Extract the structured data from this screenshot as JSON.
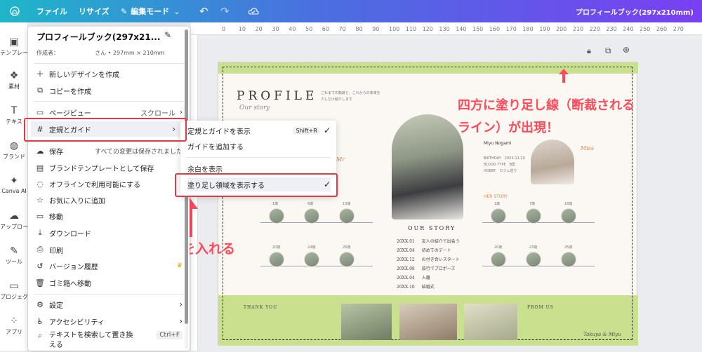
{
  "topbar": {
    "home_icon": "home-icon",
    "file": "ファイル",
    "resize": "リサイズ",
    "edit_mode": "編集モード",
    "doc_title": "プロフィールブック(297x210mm)"
  },
  "rail": [
    {
      "label": "テンプレー",
      "icon": "template-icon"
    },
    {
      "label": "素材",
      "icon": "elements-icon"
    },
    {
      "label": "テキス",
      "icon": "text-icon"
    },
    {
      "label": "ブランド",
      "icon": "brand-icon"
    },
    {
      "label": "Canva AI",
      "icon": "ai-icon"
    },
    {
      "label": "アップロー",
      "icon": "upload-icon"
    },
    {
      "label": "ツール",
      "icon": "tools-icon"
    },
    {
      "label": "プロジェク",
      "icon": "projects-icon"
    },
    {
      "label": "アプリ",
      "icon": "apps-icon"
    }
  ],
  "menu": {
    "title": "プロフィールブック(297x21...",
    "author_label": "作成者：",
    "author_suffix": "さん • 297mm × 210mm",
    "items": {
      "new_design": "新しいデザインを作成",
      "copy": "コピーを作成",
      "page_view": "ページビュー",
      "page_view_value": "スクロール",
      "rulers_guides": "定規とガイド",
      "save": "保存",
      "save_status": "すべての変更は保存されました",
      "save_brand": "ブランドテンプレートとして保存",
      "offline": "オフラインで利用可能にする",
      "favorite": "お気に入りに追加",
      "move": "移動",
      "download": "ダウンロード",
      "print": "印刷",
      "version": "バージョン履歴",
      "trash": "ゴミ箱へ移動",
      "settings": "設定",
      "accessibility": "アクセシビリティ",
      "find_replace": "テキストを検索して置き換",
      "find_replace_2": "える",
      "find_shortcut": "Ctrl+F"
    }
  },
  "submenu": {
    "show_rulers": "定規とガイドを表示",
    "show_rulers_shortcut": "Shift+R",
    "add_guides": "ガイドを追加する",
    "show_margins": "余白を表示",
    "show_bleed": "塗り足し領域を表示する"
  },
  "ruler_ticks": [
    "0",
    "10",
    "20",
    "30",
    "40",
    "50",
    "60",
    "70",
    "80",
    "90",
    "100",
    "110",
    "120",
    "130",
    "140",
    "150",
    "160",
    "170",
    "180",
    "190",
    "200",
    "210",
    "220",
    "230",
    "240",
    "250",
    "260",
    "270"
  ],
  "annotations": {
    "bleed_note_1": "四方に塗り足し線（断裁される",
    "bleed_note_2": "ライン）が出現！",
    "check_note": "チェックを入れる"
  },
  "page": {
    "profile_title": "PROFILE",
    "script_sub": "Our story",
    "intro_1": "これまでの軌跡と、これからの未来を",
    "intro_2": "少しだけ紹介します",
    "bride_name": "Miyu Nogami",
    "bride_info_1": "BIRTHDAY　20XX.11.20",
    "bride_info_2": "BLOOD TYPE　B型",
    "bride_info_3": "HOBBY　カフェ巡り",
    "miss_label": "Miss",
    "mr_label": "Mr",
    "our_story": "OUR STORY",
    "her_story": "HER STORY",
    "story": [
      {
        "date": "20XX.01",
        "text": "友人の紹介で出会う"
      },
      {
        "date": "20XX.04",
        "text": "初めてのデート"
      },
      {
        "date": "20XX.12",
        "text": "お付き合いスタート"
      },
      {
        "date": "20XX.08",
        "text": "旅行でプロポーズ"
      },
      {
        "date": "20XX.04",
        "text": "入籍"
      },
      {
        "date": "20XX.10",
        "text": "結婚式"
      }
    ],
    "his_ages_top": [
      "1歳",
      "6歳",
      "13歳"
    ],
    "his_ages_bottom": [
      "20歳",
      "24歳",
      "26歳"
    ],
    "her_ages_top": [
      "1歳",
      "7歳",
      "18歳"
    ],
    "her_ages_bottom": [
      "20歳",
      "23歳",
      "25歳"
    ],
    "thank_you": "THANK YOU",
    "from_us": "FROM US",
    "signature": "Takuya & Miyu"
  },
  "colors": {
    "accent_green": "#c9e08f",
    "annotation_red": "#ff4a5a",
    "highlight_border": "#e63946"
  }
}
